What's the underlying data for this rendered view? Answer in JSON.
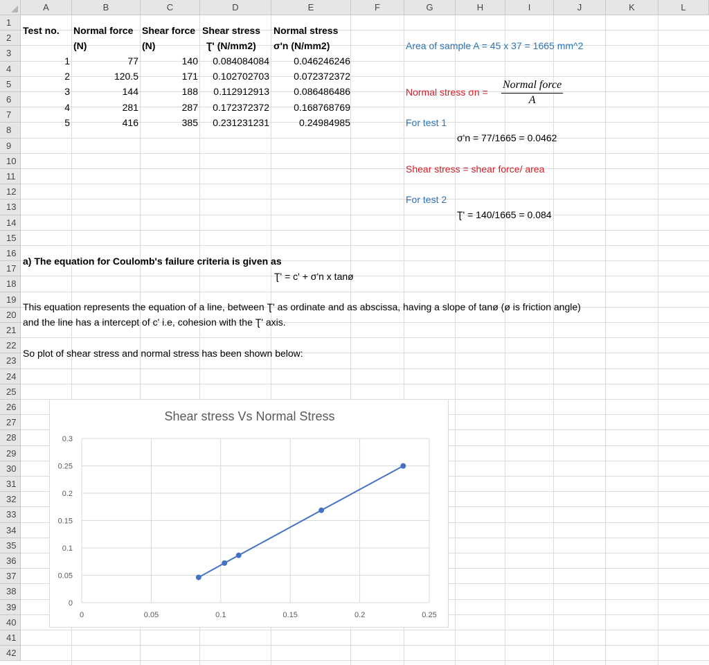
{
  "columns": [
    "A",
    "B",
    "C",
    "D",
    "E",
    "F",
    "G",
    "H",
    "I",
    "J",
    "K",
    "L"
  ],
  "rows": [
    "1",
    "2",
    "3",
    "4",
    "5",
    "6",
    "7",
    "8",
    "9",
    "10",
    "11",
    "12",
    "13",
    "14",
    "15",
    "16",
    "17",
    "18",
    "19",
    "20",
    "21",
    "22",
    "23",
    "24",
    "25",
    "26",
    "27",
    "28",
    "29",
    "30",
    "31",
    "32",
    "33",
    "34",
    "35",
    "36",
    "37",
    "38",
    "39",
    "40",
    "41",
    "42"
  ],
  "table": {
    "header1": {
      "a": "Test no.",
      "b": "Normal force",
      "c": "Shear force",
      "d": "Shear stress",
      "e": "Normal stress"
    },
    "header2": {
      "b": "(N)",
      "c": "(N)",
      "d": "Ʈ' (N/mm2)",
      "e": "σ'n  (N/mm2)"
    },
    "rows": [
      [
        "1",
        "77",
        "140",
        "0.084084084",
        "0.046246246"
      ],
      [
        "2",
        "120.5",
        "171",
        "0.102702703",
        "0.072372372"
      ],
      [
        "3",
        "144",
        "188",
        "0.112912913",
        "0.086486486"
      ],
      [
        "4",
        "281",
        "287",
        "0.172372372",
        "0.168768769"
      ],
      [
        "5",
        "416",
        "385",
        "0.231231231",
        "0.24984985"
      ]
    ]
  },
  "notes": {
    "area": "Area of sample A = 45 x 37 = 1665 mm^2",
    "normal_stress_label": "Normal stress σn =",
    "normal_stress_num": "Normal force",
    "normal_stress_den": "A",
    "for_test1": "For test 1",
    "calc1": "σ'n = 77/1665 = 0.0462",
    "shear_stress_label": "Shear stress = shear force/ area",
    "for_test2": "For test 2",
    "calc2": "Ʈ' = 140/1665 = 0.084"
  },
  "text": {
    "r16": "a) The equation for Coulomb's failure criteria is given as",
    "r17": "Ʈ' = c' + σ'n x tanø",
    "r19": "This equation represents the equation of a line, between Ʈ' as ordinate and  as abscissa, having a slope of tanø  (ø is friction angle)",
    "r20": "and the line has a intercept of c' i.e, cohesion with the Ʈ' axis.",
    "r22": "So plot of shear stress and normal stress has been shown below:"
  },
  "colors": {
    "series": "#4472c4",
    "blue_text": "#2e74b5",
    "red_text": "#d0202a"
  },
  "chart_data": {
    "type": "scatter",
    "title": "Shear stress Vs Normal Stress",
    "x": [
      0.084084084,
      0.102702703,
      0.112912913,
      0.172372372,
      0.231231231
    ],
    "y": [
      0.046246246,
      0.072372372,
      0.086486486,
      0.168768769,
      0.24984985
    ],
    "xlim": [
      0,
      0.25
    ],
    "ylim": [
      0,
      0.3
    ],
    "x_ticks": [
      "0",
      "0.05",
      "0.1",
      "0.15",
      "0.2",
      "0.25"
    ],
    "y_ticks": [
      "0",
      "0.05",
      "0.1",
      "0.15",
      "0.2",
      "0.25",
      "0.3"
    ],
    "grid": true,
    "lines_connecting_points": true
  }
}
